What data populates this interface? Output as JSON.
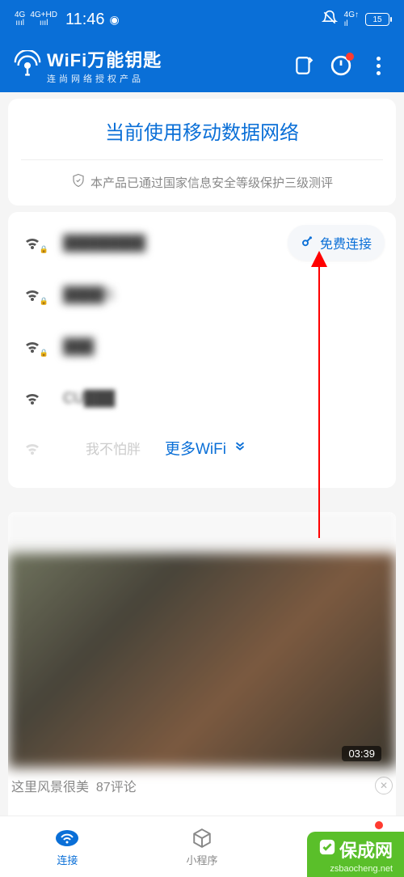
{
  "status": {
    "time": "11:46",
    "net1": "4G",
    "net2": "4G+HD",
    "battery": "15"
  },
  "header": {
    "title": "WiFi万能钥匙",
    "subtitle": "连尚网络授权产品"
  },
  "banner": "当前使用移动数据网络",
  "security_text": "本产品已通过国家信息安全等级保护三级测评",
  "connect_btn": "免费连接",
  "wifi": [
    {
      "ssid": "████████",
      "locked": true
    },
    {
      "ssid": "████S",
      "locked": true
    },
    {
      "ssid": "███",
      "locked": true
    },
    {
      "ssid": "CU███",
      "locked": false
    }
  ],
  "more": {
    "weak_label": "我不怕胖",
    "link": "更多WiFi"
  },
  "feed": {
    "duration": "03:39",
    "caption": "这里风景很美",
    "comments": "87评论"
  },
  "nav": {
    "connect": "连接",
    "mini": "小程序"
  },
  "watermark": {
    "brand": "保成网",
    "url": "zsbaocheng.net"
  }
}
